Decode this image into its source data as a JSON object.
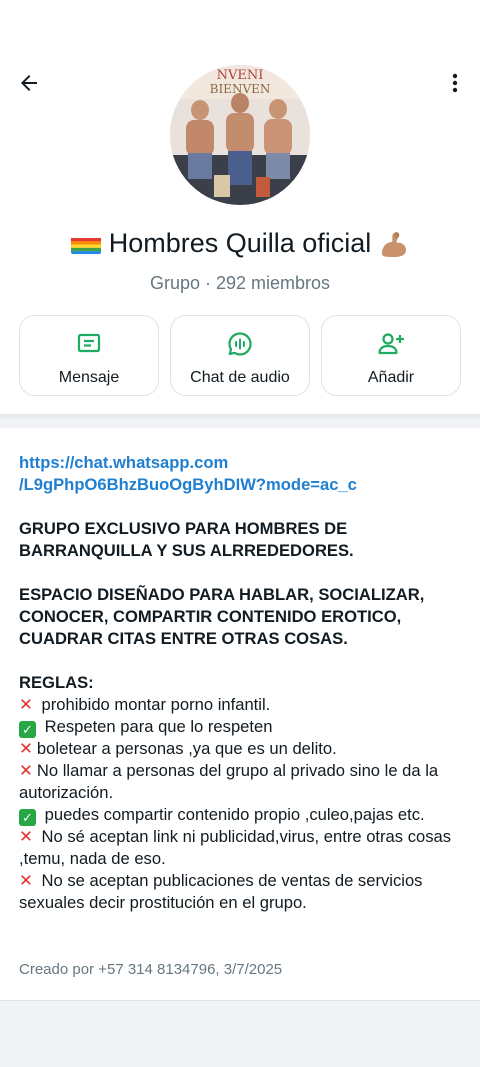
{
  "header": {
    "back_icon": "arrow-left-icon",
    "more_icon": "more-vertical-icon"
  },
  "group": {
    "name": "Hombres Quilla oficial",
    "subtitle": "Grupo · 292 miembros",
    "flag_icon": "rainbow-flag-icon",
    "emoji_icon": "flexed-biceps-icon"
  },
  "actions": {
    "message": "Mensaje",
    "audio": "Chat de audio",
    "add": "Añadir"
  },
  "description": {
    "link_line1": "https://chat.whatsapp.com",
    "link_line2": "/L9gPhpO6BhzBuoOgByhDIW?mode=ac_c",
    "title": "GRUPO EXCLUSIVO PARA HOMBRES DE BARRANQUILLA Y SUS ALRREDEDORES.",
    "purpose": "ESPACIO DISEÑADO PARA HABLAR, SOCIALIZAR, CONOCER, COMPARTIR CONTENIDO EROTICO, CUADRAR CITAS ENTRE OTRAS COSAS.",
    "rules_heading": "REGLAS:",
    "rules": [
      {
        "mark": "x",
        "text": " prohibido montar porno infantil."
      },
      {
        "mark": "check",
        "text": " Respeten para que lo respeten"
      },
      {
        "mark": "x",
        "text": "boletear a personas ,ya que es un delito."
      },
      {
        "mark": "x",
        "text": "No llamar a personas del grupo al privado sino le da la autorización."
      },
      {
        "mark": "check",
        "text": " puedes compartir contenido propio ,culeo,pajas etc."
      },
      {
        "mark": "x",
        "text": " No sé aceptan link ni publicidad,virus, entre otras cosas ,temu, nada de eso."
      },
      {
        "mark": "x",
        "text": " No se aceptan publicaciones  de ventas de servicios sexuales decir prostitución en el grupo."
      }
    ],
    "created": "Creado por +57 314 8134796, 3/7/2025"
  },
  "colors": {
    "accent_green": "#1daa61",
    "link_blue": "#1f7fd1",
    "x_red": "#e0332c",
    "check_green": "#27a845"
  }
}
